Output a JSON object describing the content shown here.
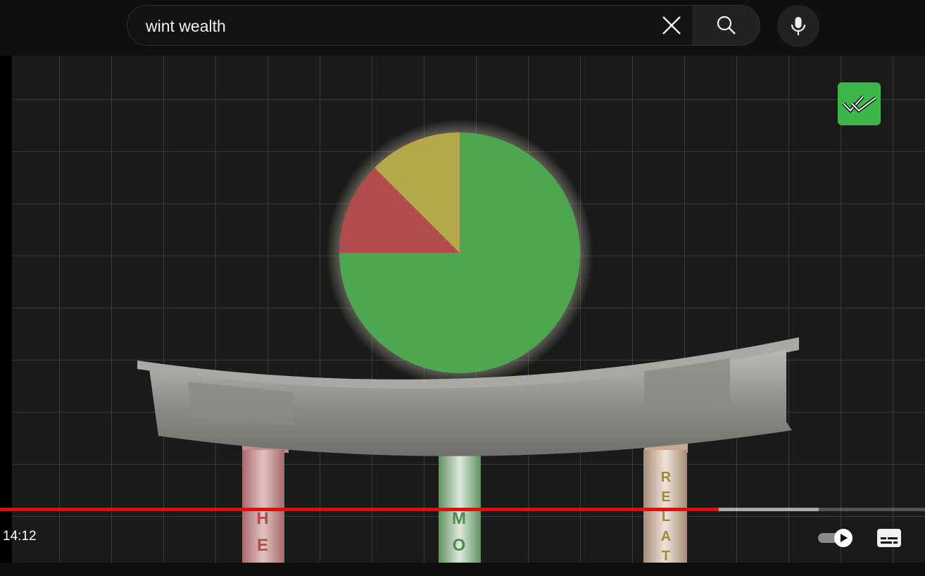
{
  "search": {
    "query": "wint wealth",
    "clear_icon": "close-icon",
    "search_icon": "search-icon",
    "mic_icon": "microphone-icon"
  },
  "video": {
    "pie": {
      "slices": [
        {
          "color": "#4fa650",
          "fraction": 0.75
        },
        {
          "color": "#b04c4c",
          "fraction": 0.125
        },
        {
          "color": "#b5a84a",
          "fraction": 0.125
        }
      ]
    },
    "pillars": [
      {
        "letters": "HEA",
        "color": "#c98a8a"
      },
      {
        "letters": "MO",
        "color": "#7fb27f"
      },
      {
        "letters": "RELAT",
        "color": "#d2b49c"
      }
    ],
    "channel_badge_icon": "double-check-logo-icon"
  },
  "player": {
    "current_time": "14:12",
    "progress_played": 0.777,
    "progress_buffered": 0.885,
    "autoplay_icon": "autoplay-toggle-icon",
    "captions_icon": "subtitles-icon"
  }
}
